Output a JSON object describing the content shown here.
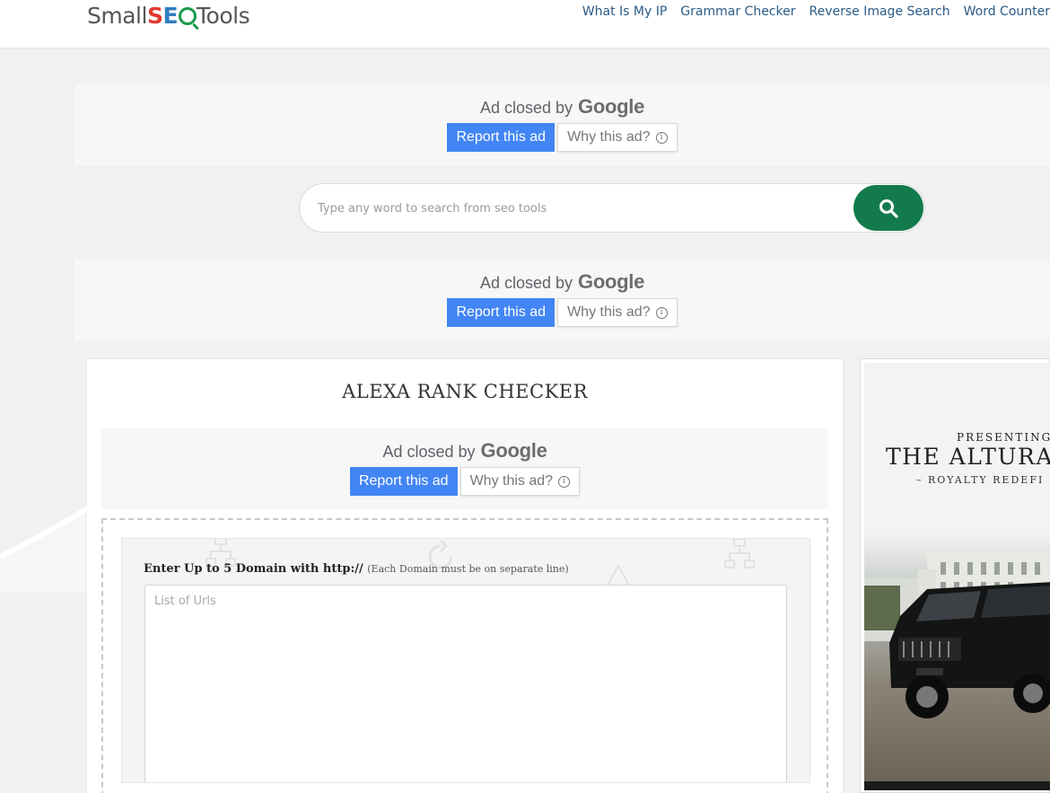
{
  "header": {
    "logo": {
      "small": "Small",
      "seo_s": "S",
      "seo_e": "E",
      "tools": "Tools"
    },
    "nav": [
      "What Is My IP",
      "Grammar Checker",
      "Reverse Image Search",
      "Word Counter"
    ]
  },
  "ad": {
    "closed_by": "Ad closed by",
    "google": "Google",
    "report": "Report this ad",
    "why": "Why this ad?",
    "info_glyph": "i"
  },
  "search": {
    "placeholder": "Type any word to search from seo tools",
    "icon": "search-icon"
  },
  "tool": {
    "title": "ALEXA RANK CHECKER",
    "label": "Enter Up to 5 Domain with http://",
    "hint": "(Each Domain must be on separate line)",
    "textarea_placeholder": "List of Urls",
    "textarea_value": ""
  },
  "side_ad": {
    "presenting": "PRESENTING",
    "headline": "THE ALTURA",
    "tagline": "– ROYALTY REDEFI"
  },
  "colors": {
    "accent_green": "#137b4b",
    "ad_blue": "#4285f4",
    "nav_link": "#2b5b86"
  }
}
